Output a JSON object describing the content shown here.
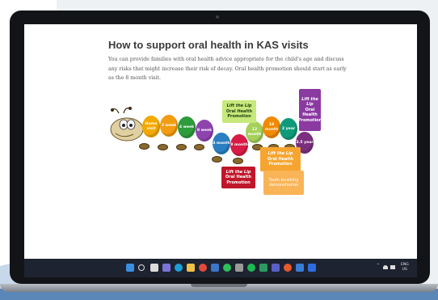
{
  "page": {
    "title": "How to support oral health in KAS visits",
    "intro": "You can provide families with oral health advice appropriate for the child's age and discuss any risks that might increase their risk of decay. Oral health promotion should start as early as the 8 month visit."
  },
  "segments": [
    {
      "label": "Home visit",
      "color": "#f2a900"
    },
    {
      "label": "2 week",
      "color": "#f39c12"
    },
    {
      "label": "4 week",
      "color": "#2e9b3c"
    },
    {
      "label": "8 week",
      "color": "#8e44ad"
    },
    {
      "label": "4 month",
      "color": "#2a7fc2"
    },
    {
      "label": "8 month",
      "color": "#d81b46"
    },
    {
      "label": "12 month",
      "color": "#a5d05a"
    },
    {
      "label": "18 month",
      "color": "#f08a00"
    },
    {
      "label": "2 year",
      "color": "#0f9a7a"
    },
    {
      "label": "3.5 year",
      "color": "#7b2f7f"
    }
  ],
  "callouts": {
    "green": {
      "line1": "Lift the Lip",
      "line2": "Oral Health Promotion"
    },
    "purple": {
      "line1": "Lift the Lip",
      "line2": "Oral Health Promotion"
    },
    "red": {
      "line1": "Lift the Lip",
      "line2": "Oral Health Promotion"
    },
    "orange": {
      "line1": "Lift the Lip",
      "line2": "Oral Health Promotion"
    },
    "scroll": {
      "text": "Tooth brushing demonstration"
    }
  },
  "taskbar": {
    "lang_top": "ENG",
    "lang_bottom": "US"
  },
  "colors": {
    "green_box": "#c7e87a",
    "purple_box": "#8a3aa0",
    "red_box": "#c0162a",
    "orange_box": "#f7a531",
    "scroll_box": "#f9b457"
  }
}
